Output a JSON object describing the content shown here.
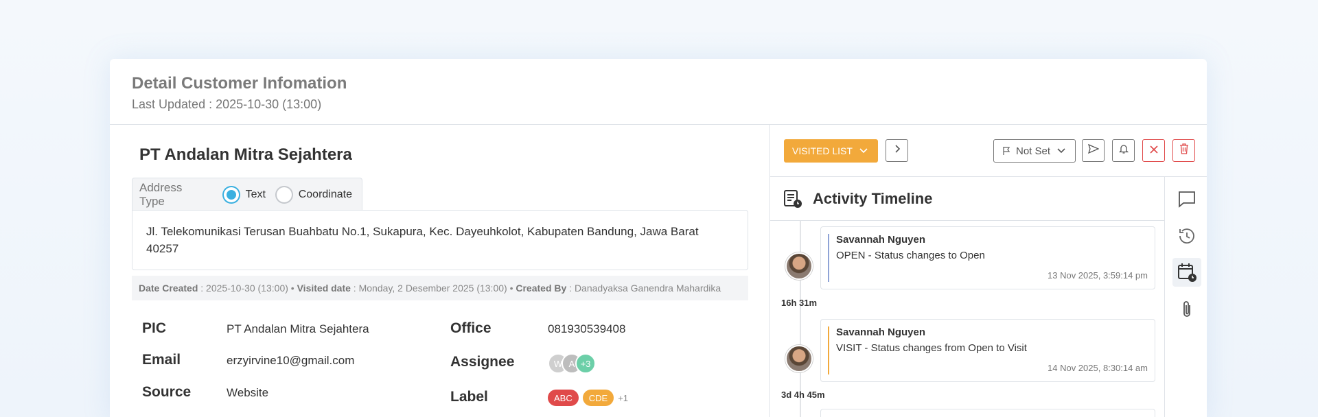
{
  "header": {
    "title": "Detail Customer Infomation",
    "last_updated": "Last Updated : 2025-10-30 (13:00)"
  },
  "customer": {
    "name": "PT Andalan Mitra Sejahtera",
    "address_type_label": "Address Type",
    "address_type_options": [
      "Text",
      "Coordinate"
    ],
    "address_type_selected": "Text",
    "address": "Jl. Telekomunikasi Terusan Buahbatu No.1, Sukapura, Kec. Dayeuhkolot, Kabupaten Bandung, Jawa Barat 40257",
    "meta": {
      "date_created_label": "Date Created",
      "date_created": " : 2025-10-30 (13:00) • ",
      "visited_label": "Visited date",
      "visited": " : Monday, 2 Desember 2025 (13:00) • ",
      "created_by_label": "Created By",
      "created_by": " : Danadyaksa Ganendra Mahardika"
    },
    "fields": {
      "pic_label": "PIC",
      "pic": "PT Andalan Mitra Sejahtera",
      "email_label": "Email",
      "email": "erzyirvine10@gmail.com",
      "source_label": "Source",
      "source": "Website",
      "office_label": "Office",
      "office": "081930539408",
      "assignee_label": "Assignee",
      "assignees": [
        "W",
        "A",
        "+3"
      ],
      "label_label": "Label",
      "labels": [
        {
          "text": "ABC",
          "color": "#e04a4a"
        },
        {
          "text": "CDE",
          "color": "#f2a93b"
        }
      ],
      "labels_more": "+1"
    }
  },
  "toolbar": {
    "status_label": "VISITED LIST",
    "flag_label": "Not Set"
  },
  "timeline": {
    "title": "Activity Timeline",
    "entries": [
      {
        "name": "Savannah Nguyen",
        "text": "OPEN - Status changes to Open",
        "time": "13 Nov 2025, 3:59:14 pm",
        "color": "#8fa3d6"
      },
      {
        "name": "Savannah Nguyen",
        "text": "VISIT - Status changes from Open to Visit",
        "time": "14 Nov 2025, 8:30:14 am",
        "color": "#f2a93b"
      }
    ],
    "durations": [
      "16h 31m",
      "3d 4h 45m"
    ]
  },
  "colors": {
    "accent": "#3ab0e0",
    "status": "#f2a93b",
    "danger": "#e04a4a"
  }
}
